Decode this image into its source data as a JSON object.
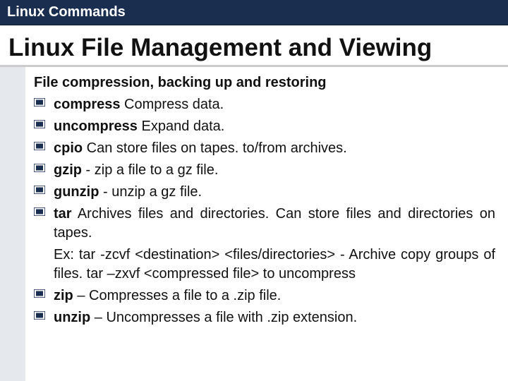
{
  "header": {
    "section": "Linux Commands"
  },
  "main": {
    "title": "Linux File Management and Viewing",
    "subheading": "File compression, backing up and restoring",
    "items": [
      {
        "cmd": "compress",
        "desc": " Compress data."
      },
      {
        "cmd": "uncompress",
        "desc": " Expand data."
      },
      {
        "cmd": "cpio",
        "desc": " Can store files on tapes. to/from archives."
      },
      {
        "cmd": "gzip",
        "desc": " - zip a file to a gz file."
      },
      {
        "cmd": "gunzip",
        "desc": " - unzip a gz file."
      },
      {
        "cmd": "tar",
        "desc": " Archives files and directories. Can store files and directories on tapes."
      },
      {
        "cmd": "zip",
        "desc": " – Compresses a file to a .zip file."
      },
      {
        "cmd": "unzip",
        "desc": " – Uncompresses a file with .zip extension."
      }
    ],
    "tar_example": "Ex: tar -zcvf <destination> <files/directories> - Archive copy groups of files. tar –zxvf <compressed file> to uncompress"
  }
}
